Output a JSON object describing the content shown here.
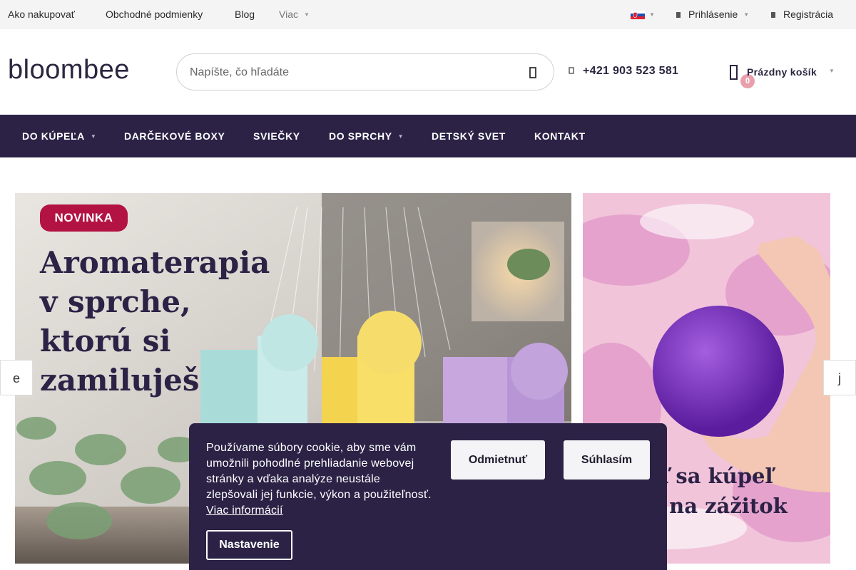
{
  "topbar": {
    "links": [
      "Ako nakupovať",
      "Obchodné podmienky",
      "Blog"
    ],
    "more_label": "Viac",
    "login_label": "Prihlásenie",
    "register_label": "Registrácia"
  },
  "header": {
    "logo_text": "bloombee",
    "search_placeholder": "Napíšte, čo hľadáte",
    "phone": "+421 903 523 581",
    "cart_label": "Prázdny košík",
    "cart_count": "0"
  },
  "nav": {
    "items": [
      "DO KÚPEĽA",
      "DARČEKOVÉ BOXY",
      "SVIEČKY",
      "DO SPRCHY",
      "DETSKÝ SVET",
      "KONTAKT"
    ]
  },
  "banner_main": {
    "badge": "NOVINKA",
    "headline_lines": [
      "Aromaterapia",
      "v sprche,",
      "ktorú si",
      "zamiluješ"
    ]
  },
  "banner_side": {
    "text_lines": [
      "ď sa kúpeľ",
      "í na zážitok"
    ]
  },
  "carousel": {
    "prev_label": "e",
    "next_label": "j"
  },
  "cookie": {
    "text": "Používame súbory cookie, aby sme vám umožnili pohodlné prehliadanie webovej stránky a vďaka analýze neustále zlepšovali jej funkcie, výkon a použiteľnosť.",
    "more_link": "Viac informácií",
    "reject_label": "Odmietnuť",
    "accept_label": "Súhlasím",
    "settings_label": "Nastavenie"
  },
  "colors": {
    "nav_bg": "#2b2246",
    "badge_new": "#b31343",
    "cart_badge": "#e8a0ad",
    "topbar_bg": "#f4f4f4"
  }
}
